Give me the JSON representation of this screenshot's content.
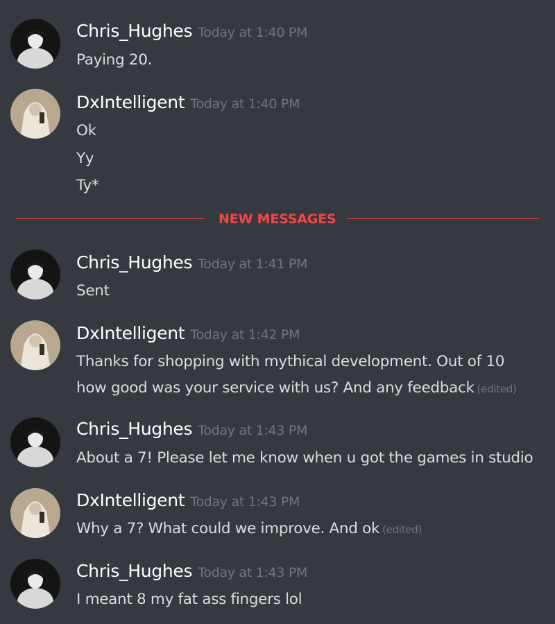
{
  "users": {
    "chris": "Chris_Hughes",
    "dx": "DxIntelligent"
  },
  "new_messages_label": "NEW MESSAGES",
  "edited_label": "(edited)",
  "messages": [
    {
      "author": "Chris_Hughes",
      "time": "Today at 1:40 PM",
      "lines": [
        "Paying 20."
      ]
    },
    {
      "author": "DxIntelligent",
      "time": "Today at 1:40 PM",
      "lines": [
        "Ok",
        "Yy",
        "Ty*"
      ]
    },
    {
      "author": "Chris_Hughes",
      "time": "Today at 1:41 PM",
      "lines": [
        "Sent"
      ]
    },
    {
      "author": "DxIntelligent",
      "time": "Today at 1:42 PM",
      "lines": [
        "Thanks for shopping with mythical development. Out of 10",
        "how good was your service with us? And any feedback"
      ],
      "edited": "(edited)"
    },
    {
      "author": "Chris_Hughes",
      "time": "Today at 1:43 PM",
      "lines": [
        "About a 7! Please let me know when u got the games in studio"
      ]
    },
    {
      "author": "DxIntelligent",
      "time": "Today at 1:43 PM",
      "lines": [
        "Why a 7? What could we improve. And ok"
      ],
      "edited": "(edited)"
    },
    {
      "author": "Chris_Hughes",
      "time": "Today at 1:43 PM",
      "lines": [
        "I meant 8 my fat ass fingers lol"
      ]
    }
  ],
  "colors": {
    "background": "#36393f",
    "username": "#ffffff",
    "timestamp": "#72767d",
    "message_text": "#dcddde",
    "new_messages_accent": "#f04747"
  },
  "icons": {
    "chris_avatar": "avatar-chris-hughes-icon",
    "dx_avatar": "avatar-dxintelligent-icon"
  }
}
